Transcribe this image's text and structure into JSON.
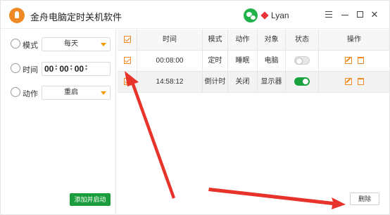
{
  "app": {
    "title": "金舟电脑定时关机软件",
    "user": "Lyan"
  },
  "form": {
    "mode_label": "模式",
    "mode_value": "每天",
    "time_label": "时间",
    "time_hh": "00",
    "time_mm": "00",
    "time_ss": "00",
    "action_label": "动作",
    "action_value": "重启",
    "add_button": "添加并启动"
  },
  "table": {
    "headers": [
      "时间",
      "模式",
      "动作",
      "对象",
      "状态",
      "操作"
    ],
    "rows": [
      {
        "time": "00:08:00",
        "mode": "定时",
        "action": "睡眠",
        "target": "电脑",
        "enabled": false
      },
      {
        "time": "14:58:12",
        "mode": "倒计时",
        "action": "关闭",
        "target": "显示器",
        "enabled": true
      }
    ]
  },
  "footer": {
    "delete_button": "删除"
  },
  "colors": {
    "accent": "#f08a24",
    "primary_green": "#1a9e3c",
    "annotation_red": "#e8332a"
  },
  "icons": [
    "app-logo-icon",
    "wechat-icon",
    "vip-gem-icon",
    "menu-icon",
    "minimize-icon",
    "maximize-icon",
    "close-icon",
    "alarm-clock-icon",
    "clock-icon",
    "gear-icon",
    "edit-icon",
    "trash-icon",
    "checkbox-icon"
  ]
}
